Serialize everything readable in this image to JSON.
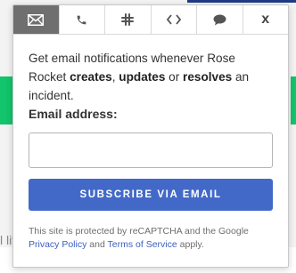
{
  "background": {
    "fragment_text": "l liv"
  },
  "tabs": [
    {
      "id": "email",
      "icon": "envelope-icon",
      "active": true
    },
    {
      "id": "sms",
      "icon": "phone-icon",
      "active": false
    },
    {
      "id": "slack",
      "icon": "slack-icon",
      "active": false
    },
    {
      "id": "webhook",
      "icon": "code-icon",
      "active": false
    },
    {
      "id": "chat",
      "icon": "speech-bubble-icon",
      "active": false
    },
    {
      "id": "close",
      "icon": "close-icon",
      "label": "x",
      "active": false
    }
  ],
  "description": {
    "part1": "Get email notifications whenever Rose Rocket ",
    "creates": "creates",
    "comma": ", ",
    "updates": "updates",
    "or": " or ",
    "resolves": "resolves",
    "part2": " an incident."
  },
  "email": {
    "label": "Email address:",
    "value": "",
    "placeholder": ""
  },
  "subscribe": {
    "label": "SUBSCRIBE VIA EMAIL"
  },
  "legal": {
    "prefix": "This site is protected by reCAPTCHA and the Google ",
    "privacy_link": "Privacy Policy",
    "and": " and ",
    "terms_link": "Terms of Service",
    "suffix": " apply."
  },
  "colors": {
    "accent": "#4369c8",
    "active_tab": "#6f6f6f",
    "status_green": "#12c46b",
    "top_bar": "#1f3b84"
  }
}
